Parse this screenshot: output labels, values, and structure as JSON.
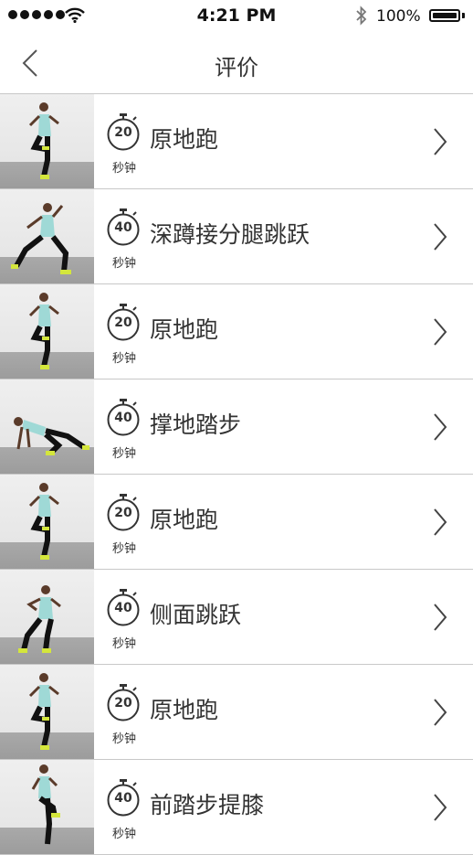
{
  "status_bar": {
    "time": "4:21 PM",
    "battery": "100%"
  },
  "header": {
    "title": "评价"
  },
  "exercises": [
    {
      "seconds": "20",
      "unit": "秒钟",
      "name": "原地跑"
    },
    {
      "seconds": "40",
      "unit": "秒钟",
      "name": "深蹲接分腿跳跃"
    },
    {
      "seconds": "20",
      "unit": "秒钟",
      "name": "原地跑"
    },
    {
      "seconds": "40",
      "unit": "秒钟",
      "name": "撑地踏步"
    },
    {
      "seconds": "20",
      "unit": "秒钟",
      "name": "原地跑"
    },
    {
      "seconds": "40",
      "unit": "秒钟",
      "name": "侧面跳跃"
    },
    {
      "seconds": "20",
      "unit": "秒钟",
      "name": "原地跑"
    },
    {
      "seconds": "40",
      "unit": "秒钟",
      "name": "前踏步提膝"
    }
  ]
}
